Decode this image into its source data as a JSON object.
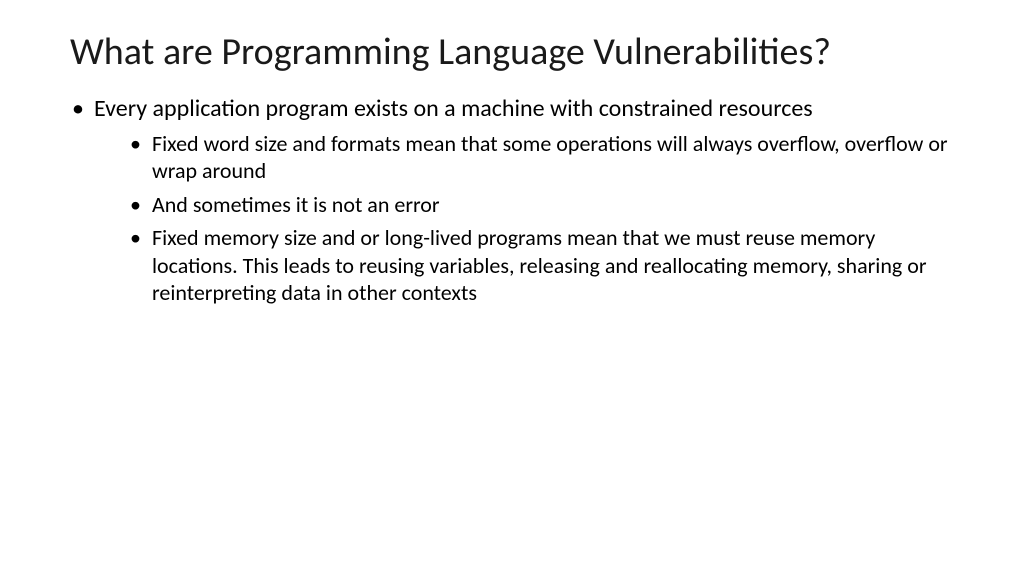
{
  "slide": {
    "title": "What are Programming Language Vulnerabilities?",
    "bullets": [
      {
        "text": "Every application program exists on a machine with constrained resources",
        "sub": [
          "Fixed word size and formats mean that some operations will always overflow, overflow or wrap around",
          "And sometimes it is not an error",
          "Fixed memory size and or long-lived programs mean that we must reuse memory locations. This leads to reusing variables, releasing and reallocating memory, sharing or reinterpreting data in other contexts"
        ]
      }
    ]
  }
}
